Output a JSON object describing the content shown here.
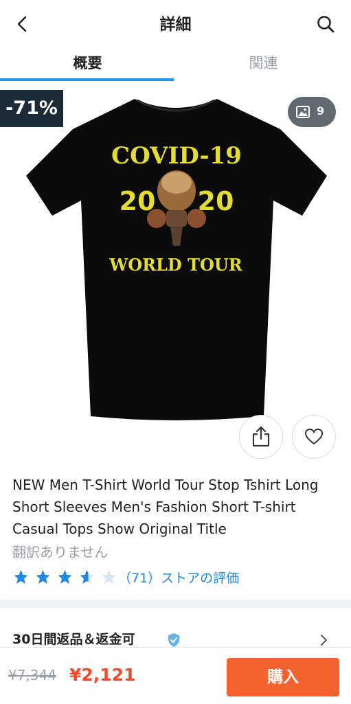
{
  "header": {
    "title": "詳細",
    "back_icon": "chevron-left-icon",
    "search_icon": "search-icon"
  },
  "tabs": [
    {
      "label": "概要",
      "active": true
    },
    {
      "label": "関連",
      "active": false
    }
  ],
  "colors": {
    "accent": "#2196e8",
    "buy": "#f4622f",
    "price": "#f24a2b",
    "star": "#1e88e5"
  },
  "product": {
    "discount": "-71%",
    "image_count": "9",
    "shirt_text": {
      "line1": "COVID-19",
      "year_left": "20",
      "year_right": "20",
      "line3": "WORLD TOUR"
    },
    "title": "NEW Men T-Shirt  World Tour Stop Tshirt Long Short Sleeves Men's Fashion Short T-shirt Casual Tops Show Original Title",
    "translation_note": "翻訳ありません",
    "rating": 3.5,
    "reviews": "（71）ストアの評価"
  },
  "returns": {
    "label": "30日間返品＆返金可"
  },
  "bottom": {
    "old_price": "¥7,344",
    "new_price": "¥2,121",
    "buy_label": "購入"
  }
}
